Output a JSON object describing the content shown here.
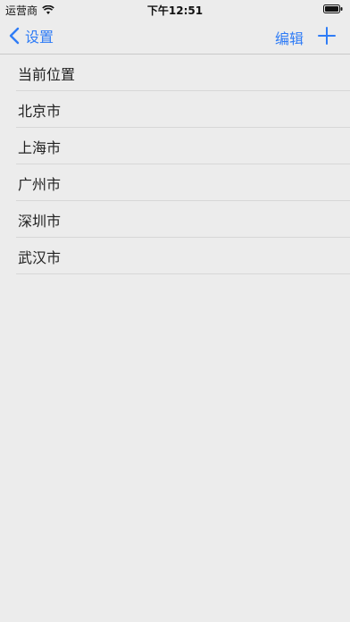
{
  "status_bar": {
    "carrier": "运营商",
    "time": "下午12:51"
  },
  "nav": {
    "back_label": "设置",
    "edit_label": "编辑",
    "add_icon": "plus-icon",
    "back_icon": "chevron-left-icon"
  },
  "list": {
    "items": [
      {
        "label": "当前位置"
      },
      {
        "label": "北京市"
      },
      {
        "label": "上海市"
      },
      {
        "label": "广州市"
      },
      {
        "label": "深圳市"
      },
      {
        "label": "武汉市"
      }
    ]
  },
  "colors": {
    "accent": "#2f7cf6",
    "background": "#ececec"
  }
}
